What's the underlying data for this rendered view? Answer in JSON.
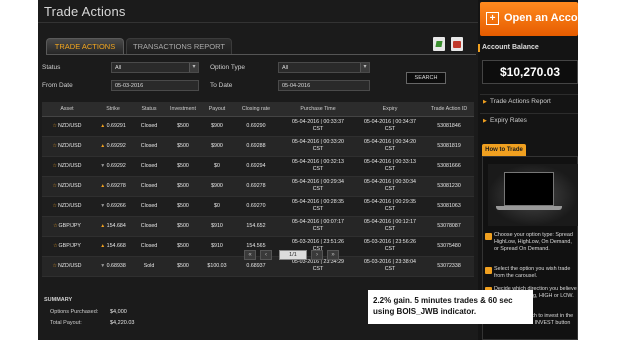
{
  "header": {
    "title": "Trade Actions"
  },
  "tabs": [
    {
      "label": "TRADE ACTIONS"
    },
    {
      "label": "TRANSACTIONS REPORT"
    }
  ],
  "filters": {
    "status_label": "Status",
    "status_value": "All",
    "from_label": "From Date",
    "from_value": "05-03-2016",
    "option_type_label": "Option Type",
    "option_type_value": "All",
    "to_label": "To Date",
    "to_value": "05-04-2016",
    "search_label": "SEARCH"
  },
  "table": {
    "columns": [
      "Asset",
      "Strike",
      "Status",
      "Investment",
      "Payout",
      "Closing rate",
      "Purchase Time",
      "Expiry",
      "Trade Action ID"
    ],
    "rows": [
      {
        "asset": "NZD/USD",
        "dir": "up",
        "strike": "0.69291",
        "status": "Closed",
        "investment": "$500",
        "payout": "$900",
        "closing": "0.69290",
        "purchase": "05-04-2016 | 00:33:37",
        "purchase_tz": "CST",
        "expiry": "05-04-2016 | 00:34:37",
        "expiry_tz": "CST",
        "id": "53081846"
      },
      {
        "asset": "NZD/USD",
        "dir": "up",
        "strike": "0.69292",
        "status": "Closed",
        "investment": "$500",
        "payout": "$900",
        "closing": "0.69288",
        "purchase": "05-04-2016 | 00:33:20",
        "purchase_tz": "CST",
        "expiry": "05-04-2016 | 00:34:20",
        "expiry_tz": "CST",
        "id": "53081819"
      },
      {
        "asset": "NZD/USD",
        "dir": "down",
        "strike": "0.69292",
        "status": "Closed",
        "investment": "$500",
        "payout": "$0",
        "closing": "0.69294",
        "purchase": "05-04-2016 | 00:32:13",
        "purchase_tz": "CST",
        "expiry": "05-04-2016 | 00:33:13",
        "expiry_tz": "CST",
        "id": "53081666"
      },
      {
        "asset": "NZD/USD",
        "dir": "up",
        "strike": "0.69278",
        "status": "Closed",
        "investment": "$500",
        "payout": "$900",
        "closing": "0.69278",
        "purchase": "05-04-2016 | 00:29:34",
        "purchase_tz": "CST",
        "expiry": "05-04-2016 | 00:30:34",
        "expiry_tz": "CST",
        "id": "53081230"
      },
      {
        "asset": "NZD/USD",
        "dir": "down",
        "strike": "0.69266",
        "status": "Closed",
        "investment": "$500",
        "payout": "$0",
        "closing": "0.69270",
        "purchase": "05-04-2016 | 00:28:35",
        "purchase_tz": "CST",
        "expiry": "05-04-2016 | 00:29:35",
        "expiry_tz": "CST",
        "id": "53081063"
      },
      {
        "asset": "GBP/JPY",
        "dir": "up",
        "strike": "154.684",
        "status": "Closed",
        "investment": "$500",
        "payout": "$910",
        "closing": "154.652",
        "purchase": "05-04-2016 | 00:07:17",
        "purchase_tz": "CST",
        "expiry": "05-04-2016 | 00:12:17",
        "expiry_tz": "CST",
        "id": "53078087"
      },
      {
        "asset": "GBP/JPY",
        "dir": "up",
        "strike": "154.668",
        "status": "Closed",
        "investment": "$500",
        "payout": "$910",
        "closing": "154.565",
        "purchase": "05-03-2016 | 23:51:26",
        "purchase_tz": "CST",
        "expiry": "05-03-2016 | 23:56:26",
        "expiry_tz": "CST",
        "id": "53075480"
      },
      {
        "asset": "NZD/USD",
        "dir": "down",
        "strike": "0.68938",
        "status": "Sold",
        "investment": "$500",
        "payout": "$100.03",
        "closing": "0.68937",
        "purchase": "05-03-2016 | 23:34:29",
        "purchase_tz": "CST",
        "expiry": "05-03-2016 | 23:38:04",
        "expiry_tz": "CST",
        "id": "53072338"
      }
    ]
  },
  "pager": {
    "first": "«",
    "prev": "‹",
    "page": "1/1",
    "next": "›",
    "last": "»"
  },
  "summary": {
    "title": "SUMMARY",
    "purchased_label": "Options Purchased:",
    "purchased_value": "$4,000",
    "payout_label": "Total Payout:",
    "payout_value": "$4,220.03"
  },
  "right_panel": {
    "open_account": "Open an Accou",
    "balance_label": "Account Balance",
    "balance_value": "$10,270.03",
    "report_link": "Trade Actions Report",
    "expiry_link": "Expiry Rates",
    "howto_tab": "How to Trade",
    "step1": "Choose your option type: Spread HighLow, HighLow, On Demand, or Spread On Demand.",
    "step2": "Select the option you wish trade from the carousel.",
    "step3": "Decide which direction you believe the asset is going, HIGH or LOW.",
    "step4": "Decide how much to invest in the trade and hit the INVEST button"
  },
  "note": {
    "text": "2.2% gain. 5 minutes trades & 60 sec using BOIS_JWB indicator."
  },
  "colors": {
    "accent": "#f0a020",
    "background": "#1b1b1b",
    "open_button": "#e65c00"
  }
}
